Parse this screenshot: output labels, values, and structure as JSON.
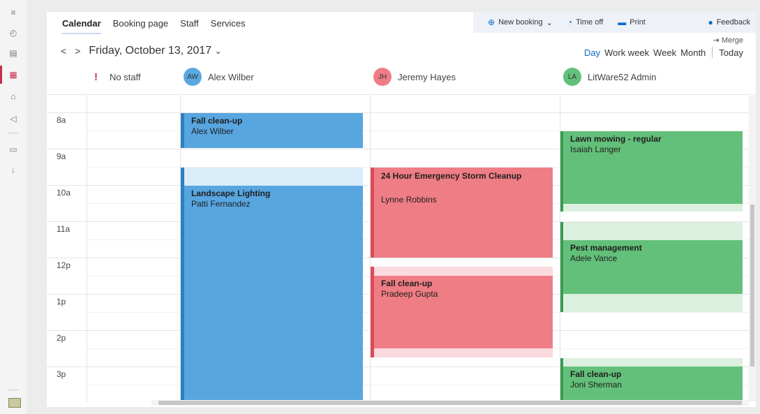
{
  "rail": {
    "items": [
      "menu-icon",
      "dashboard-icon",
      "document-icon",
      "calendar-icon",
      "briefcase-icon",
      "megaphone-icon",
      "id-card-icon",
      "download-icon"
    ]
  },
  "tabs": [
    {
      "label": "Calendar",
      "active": true
    },
    {
      "label": "Booking page"
    },
    {
      "label": "Staff"
    },
    {
      "label": "Services"
    }
  ],
  "toolbar": {
    "new_booking": "New booking",
    "time_off": "Time off",
    "print": "Print",
    "feedback": "Feedback"
  },
  "date": {
    "prev": "<",
    "next": ">",
    "title": "Friday, October 13, 2017",
    "dropdown": "⌄"
  },
  "merge": "⇥ Merge",
  "views": {
    "day": "Day",
    "work_week": "Work week",
    "week": "Week",
    "month": "Month",
    "today": "Today",
    "active": "Day"
  },
  "staff": [
    {
      "initials": "",
      "name": "No staff",
      "color": ""
    },
    {
      "initials": "AW",
      "name": "Alex Wilber",
      "color": "#5aa8e0"
    },
    {
      "initials": "JH",
      "name": "Jeremy Hayes",
      "color": "#ee7d86"
    },
    {
      "initials": "LA",
      "name": "LitWare52 Admin",
      "color": "#62c07b"
    }
  ],
  "hours": [
    "8a",
    "9a",
    "10a",
    "11a",
    "12p",
    "1p",
    "2p",
    "3p"
  ],
  "events": {
    "alex_fall": {
      "title": "Fall clean-up",
      "person": "Alex Wilber"
    },
    "alex_lighting": {
      "title": "Landscape Lighting",
      "person": "Patti Fernandez"
    },
    "jeremy_storm": {
      "title": "24 Hour Emergency Storm Cleanup",
      "person": "Lynne Robbins"
    },
    "jeremy_fall": {
      "title": "Fall clean-up",
      "person": "Pradeep Gupta"
    },
    "admin_lawn": {
      "title": "Lawn mowing - regular",
      "person": "Isaiah Langer"
    },
    "admin_pest": {
      "title": "Pest management",
      "person": "Adele Vance"
    },
    "admin_fall": {
      "title": "Fall clean-up",
      "person": "Joni Sherman"
    }
  },
  "colors": {
    "accent": "#0b6ac6",
    "alert": "#c4314b",
    "blue": "#58a6e0",
    "red": "#ef7d85",
    "green": "#63c07a"
  }
}
